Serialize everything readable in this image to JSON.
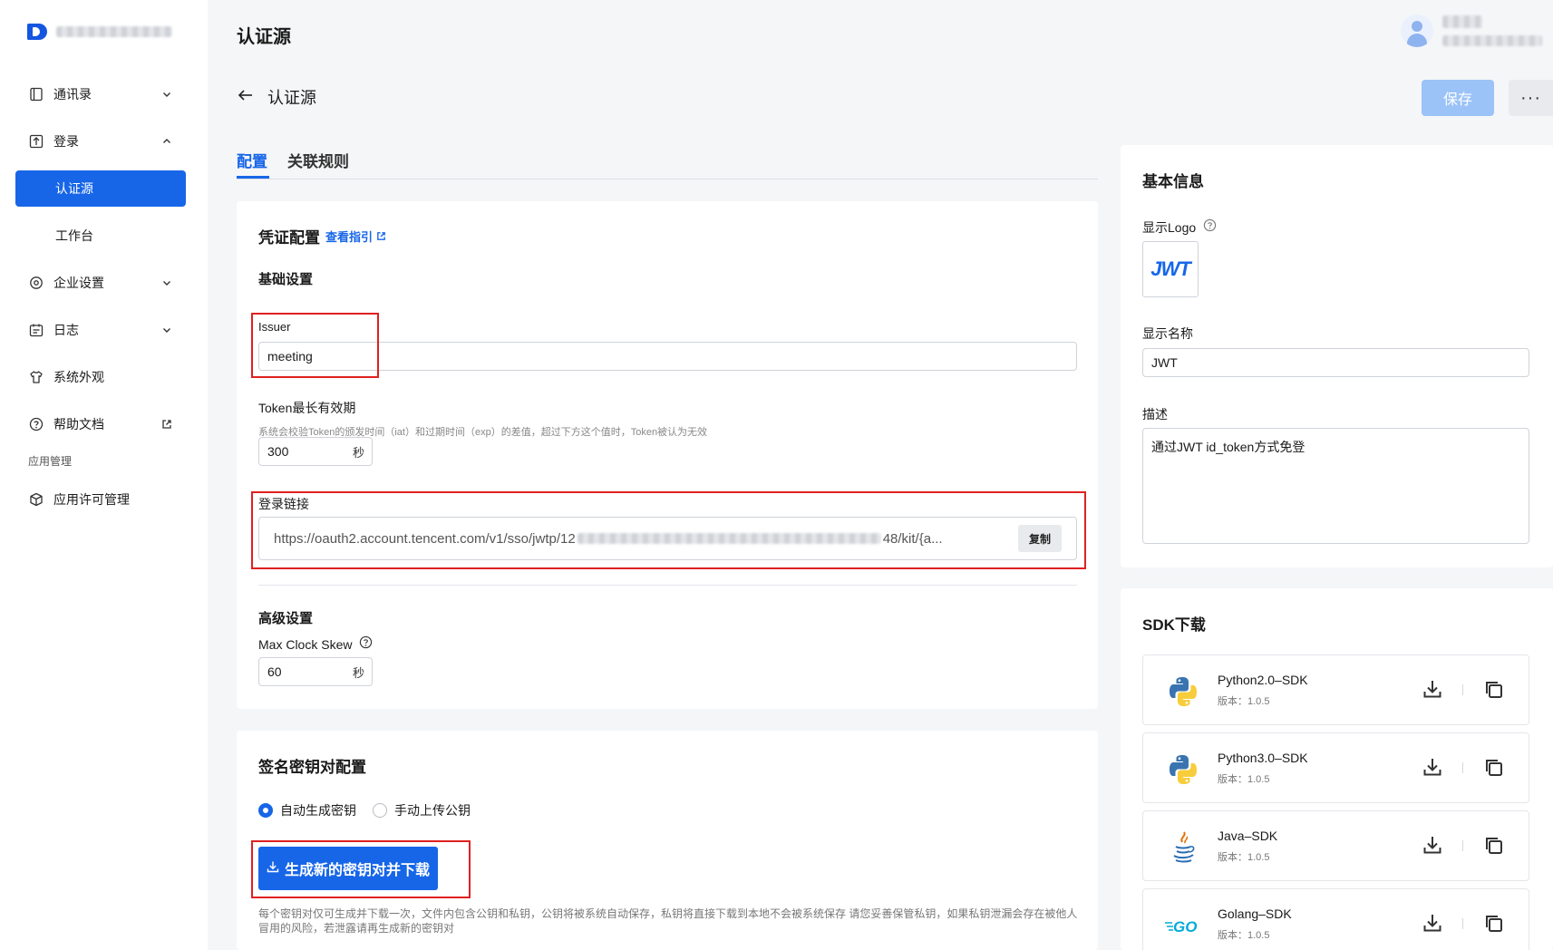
{
  "sidebar": {
    "items": [
      {
        "label": "通讯录"
      },
      {
        "label": "登录"
      },
      {
        "label": "认证源"
      },
      {
        "label": "工作台"
      },
      {
        "label": "企业设置"
      },
      {
        "label": "日志"
      },
      {
        "label": "系统外观"
      },
      {
        "label": "帮助文档"
      }
    ],
    "section_label": "应用管理",
    "app_item": "应用许可管理"
  },
  "header": {
    "title": "认证源",
    "back_title": "认证源",
    "save_label": "保存",
    "more_label": "···"
  },
  "tabs": [
    {
      "label": "配置"
    },
    {
      "label": "关联规则"
    }
  ],
  "credential": {
    "title": "凭证配置",
    "guide_link": "查看指引",
    "basic_title": "基础设置",
    "issuer_label": "Issuer",
    "issuer_value": "meeting",
    "token_label": "Token最长有效期",
    "token_hint": "系统会校验Token的颁发时间（iat）和过期时间（exp）的差值，超过下方这个值时，Token被认为无效",
    "token_value": "300",
    "unit_sec": "秒",
    "login_link_label": "登录链接",
    "login_link_prefix": "https://oauth2.account.tencent.com/v1/sso/jwtp/12",
    "login_link_suffix": "48/kit/{a...",
    "copy_label": "复制",
    "advanced_title": "高级设置",
    "clock_skew_label": "Max Clock Skew",
    "clock_skew_value": "60"
  },
  "signing": {
    "title": "签名密钥对配置",
    "option_auto": "自动生成密钥",
    "option_manual": "手动上传公钥",
    "generate_label": "生成新的密钥对并下载",
    "note": "每个密钥对仅可生成并下载一次，文件内包含公钥和私钥，公钥将被系统自动保存，私钥将直接下载到本地不会被系统保存 请您妥善保管私钥，如果私钥泄漏会存在被他人冒用的风险，若泄露请再生成新的密钥对"
  },
  "basic_info": {
    "title": "基本信息",
    "logo_label": "显示Logo",
    "logo_text": "JWT",
    "name_label": "显示名称",
    "name_value": "JWT",
    "desc_label": "描述",
    "desc_value": "通过JWT id_token方式免登"
  },
  "sdk": {
    "title": "SDK下载",
    "items": [
      {
        "name": "Python2.0–SDK",
        "version": "版本：1.0.5",
        "icon": "python-icon"
      },
      {
        "name": "Python3.0–SDK",
        "version": "版本：1.0.5",
        "icon": "python-icon"
      },
      {
        "name": "Java–SDK",
        "version": "版本：1.0.5",
        "icon": "java-icon"
      },
      {
        "name": "Golang–SDK",
        "version": "版本：1.0.5",
        "icon": "golang-icon"
      }
    ]
  },
  "colors": {
    "primary": "#1766e8",
    "save_disabled": "#9bc3f7",
    "highlight_red": "#e02020"
  }
}
